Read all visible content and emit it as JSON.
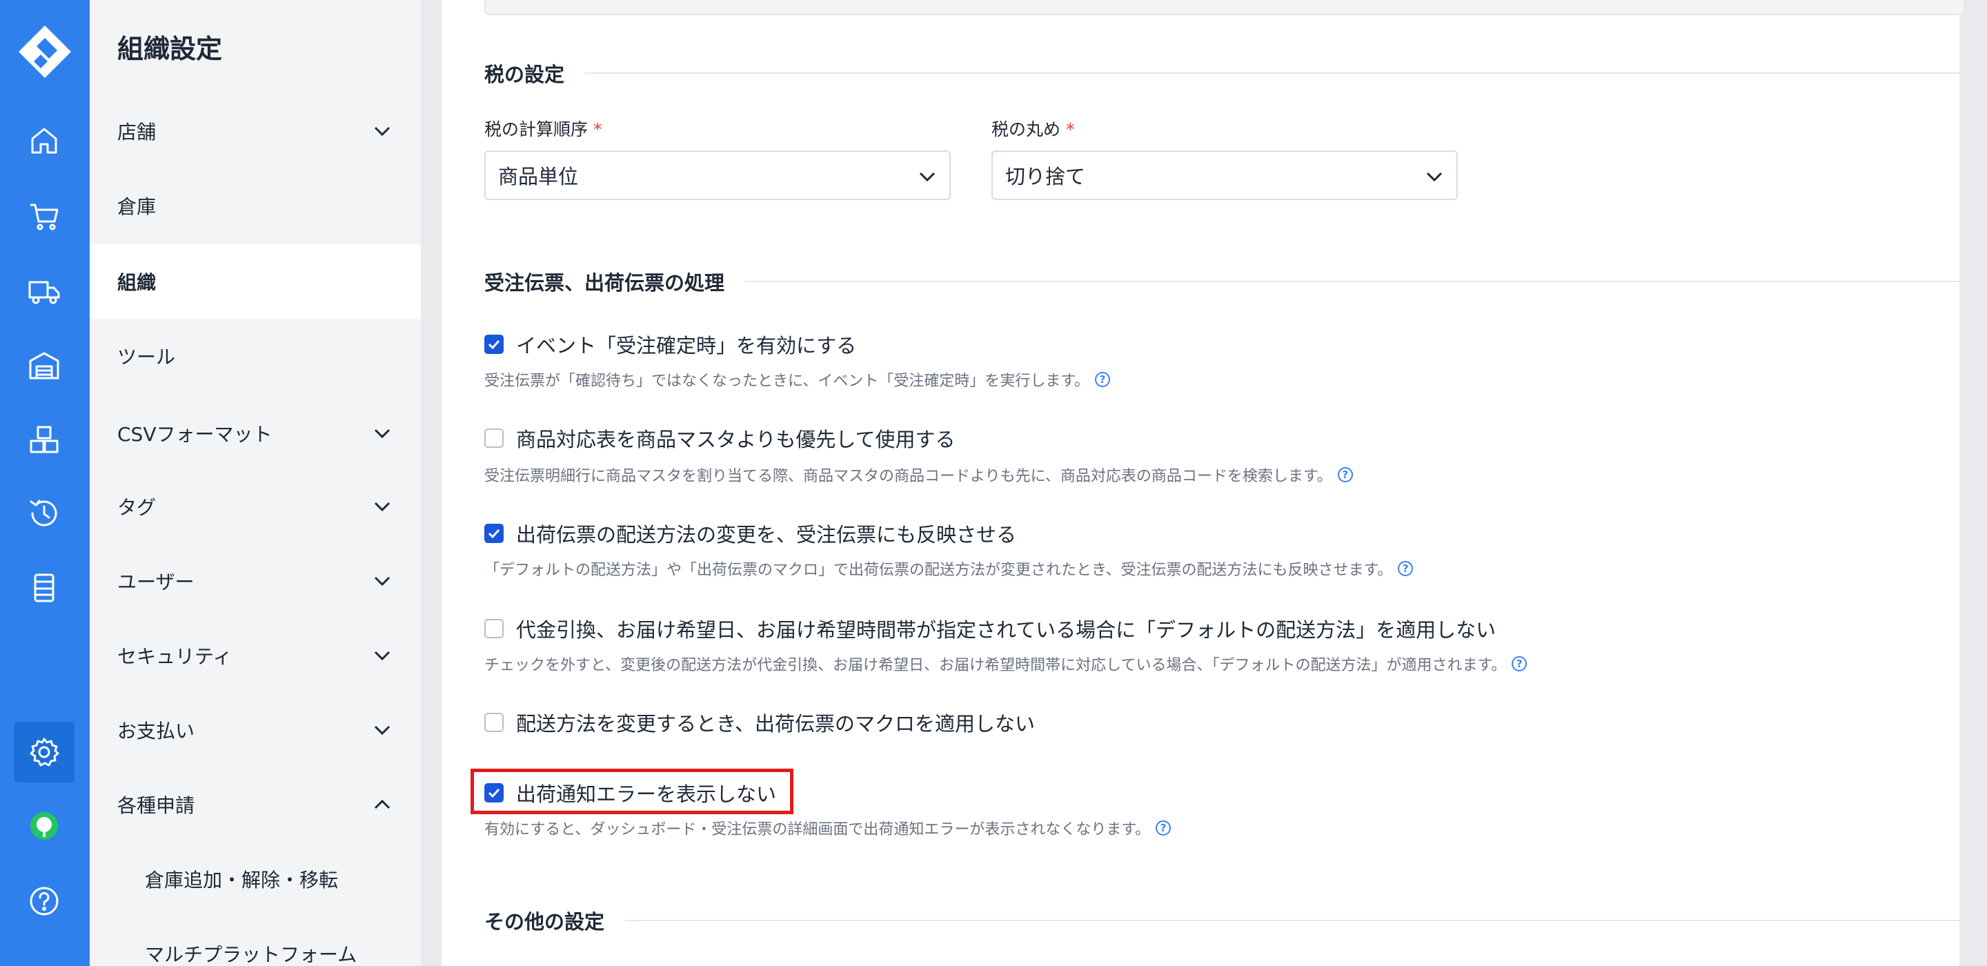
{
  "rail": {
    "items": [
      {
        "name": "home-icon"
      },
      {
        "name": "cart-icon"
      },
      {
        "name": "truck-icon"
      },
      {
        "name": "warehouse-icon"
      },
      {
        "name": "boxes-icon"
      },
      {
        "name": "history-icon"
      },
      {
        "name": "database-icon"
      },
      {
        "name": "settings-icon",
        "active": true
      },
      {
        "name": "chat-icon"
      },
      {
        "name": "help-icon"
      }
    ]
  },
  "sidebar": {
    "title": "組織設定",
    "items": [
      {
        "label": "店舗",
        "expandable": true
      },
      {
        "label": "倉庫"
      },
      {
        "label": "組織",
        "active": true
      },
      {
        "label": "ツール"
      },
      {
        "label": "CSVフォーマット",
        "expandable": true
      },
      {
        "label": "タグ",
        "expandable": true
      },
      {
        "label": "ユーザー",
        "expandable": true
      },
      {
        "label": "セキュリティ",
        "expandable": true
      },
      {
        "label": "お支払い",
        "expandable": true
      },
      {
        "label": "各種申請",
        "expanded": true
      },
      {
        "label": "倉庫追加・解除・移転",
        "sub": true
      },
      {
        "label": "マルチプラットフォーム",
        "sub": true
      }
    ]
  },
  "tax": {
    "heading": "税の設定",
    "order_label": "税の計算順序",
    "order_value": "商品単位",
    "rounding_label": "税の丸め",
    "rounding_value": "切り捨て",
    "required_mark": "*"
  },
  "processing": {
    "heading": "受注伝票、出荷伝票の処理",
    "options": [
      {
        "label": "イベント「受注確定時」を有効にする",
        "checked": true,
        "help": "受注伝票が「確認待ち」ではなくなったときに、イベント「受注確定時」を実行します。"
      },
      {
        "label": "商品対応表を商品マスタよりも優先して使用する",
        "checked": false,
        "help": "受注伝票明細行に商品マスタを割り当てる際、商品マスタの商品コードよりも先に、商品対応表の商品コードを検索します。"
      },
      {
        "label": "出荷伝票の配送方法の変更を、受注伝票にも反映させる",
        "checked": true,
        "help": "「デフォルトの配送方法」や「出荷伝票のマクロ」で出荷伝票の配送方法が変更されたとき、受注伝票の配送方法にも反映させます。"
      },
      {
        "label": "代金引換、お届け希望日、お届け希望時間帯が指定されている場合に「デフォルトの配送方法」を適用しない",
        "checked": false,
        "help": "チェックを外すと、変更後の配送方法が代金引換、お届け希望日、お届け希望時間帯に対応している場合、「デフォルトの配送方法」が適用されます。"
      },
      {
        "label": "配送方法を変更するとき、出荷伝票のマクロを適用しない",
        "checked": false,
        "help": ""
      },
      {
        "label": "出荷通知エラーを表示しない",
        "checked": true,
        "help": "有効にすると、ダッシュボード・受注伝票の詳細画面で出荷通知エラーが表示されなくなります。"
      }
    ],
    "help_mark": "?"
  },
  "other": {
    "heading": "その他の設定"
  },
  "colors": {
    "rail": "#2f80ed",
    "checkbox": "#1a56db",
    "highlight": "#e41b1b",
    "required": "#e53935"
  }
}
